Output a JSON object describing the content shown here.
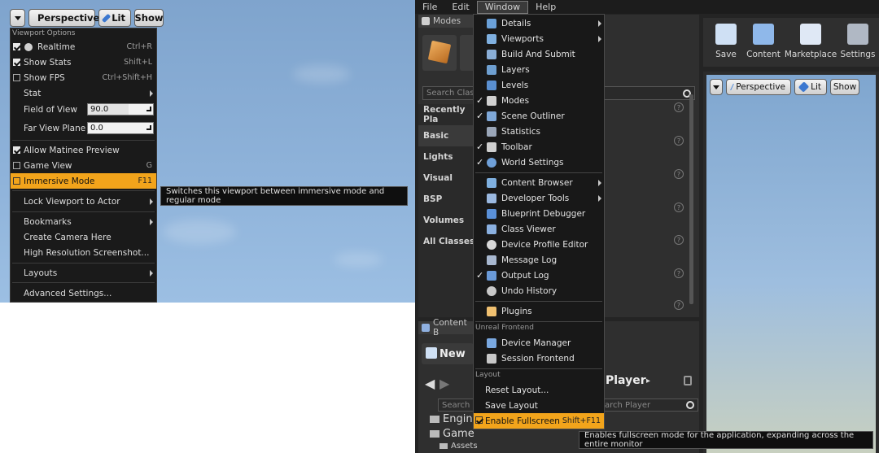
{
  "left_viewport": {
    "toolbar": {
      "perspective_label": "Perspective",
      "lit_label": "Lit",
      "show_label": "Show"
    },
    "menu": {
      "header": "Viewport Options",
      "realtime": {
        "label": "Realtime",
        "shortcut": "Ctrl+R",
        "checked": true
      },
      "show_stats": {
        "label": "Show Stats",
        "shortcut": "Shift+L",
        "checked": true
      },
      "show_fps": {
        "label": "Show FPS",
        "shortcut": "Ctrl+Shift+H",
        "checked": false
      },
      "stat_label": "Stat",
      "fov_label": "Field of View",
      "fov_value": "90.0",
      "far_view_label": "Far View Plane",
      "far_view_value": "0.0",
      "matinee": {
        "label": "Allow Matinee Preview",
        "checked": true
      },
      "game_view": {
        "label": "Game View",
        "shortcut": "G",
        "checked": false
      },
      "immersive": {
        "label": "Immersive Mode",
        "shortcut": "F11",
        "checked": false
      },
      "lock_viewport": "Lock Viewport to Actor",
      "bookmarks": "Bookmarks",
      "create_camera": "Create Camera Here",
      "hires_screenshot": "High Resolution Screenshot...",
      "layouts": "Layouts",
      "advanced": "Advanced Settings..."
    },
    "tooltip": "Switches this viewport between immersive mode and regular mode"
  },
  "editor": {
    "menubar": [
      "File",
      "Edit",
      "Window",
      "Help"
    ],
    "modes_tab": "Modes",
    "search_placeholder": "Search Clas",
    "categories": [
      "Recently Pla",
      "Basic",
      "Lights",
      "Visual",
      "BSP",
      "Volumes",
      "All Classes"
    ],
    "toolbar": {
      "save": "Save",
      "content": "Content",
      "marketplace": "Marketplace",
      "settings": "Settings"
    },
    "viewport": {
      "perspective": "Perspective",
      "lit": "Lit",
      "show": "Show"
    },
    "content_browser": {
      "tab": "Content B",
      "new_label": "New",
      "search_placeholder": "Search F",
      "player_label": "Player",
      "search_player_placeholder": "arch Player",
      "tree": [
        "Engine",
        "Game",
        "Assets"
      ]
    },
    "window_menu": {
      "items": [
        {
          "label": "Details",
          "sub": true,
          "checked": false,
          "icon": "details-icon",
          "color": "#6aa0d8"
        },
        {
          "label": "Viewports",
          "sub": true,
          "checked": false,
          "icon": "viewports-icon",
          "color": "#7fb0e0"
        },
        {
          "label": "Build And Submit",
          "sub": false,
          "checked": false,
          "icon": "build-icon",
          "color": "#8aaed6"
        },
        {
          "label": "Layers",
          "sub": false,
          "checked": false,
          "icon": "layers-icon",
          "color": "#6e9fd0"
        },
        {
          "label": "Levels",
          "sub": false,
          "checked": false,
          "icon": "levels-icon",
          "color": "#5a8fd0"
        },
        {
          "label": "Modes",
          "sub": false,
          "checked": true,
          "icon": "wrench-icon",
          "color": "#d0d0d0"
        },
        {
          "label": "Scene Outliner",
          "sub": false,
          "checked": true,
          "icon": "outliner-icon",
          "color": "#7fa8d8"
        },
        {
          "label": "Statistics",
          "sub": false,
          "checked": false,
          "icon": "statistics-icon",
          "color": "#9aa6b8"
        },
        {
          "label": "Toolbar",
          "sub": false,
          "checked": true,
          "icon": "toolbar-icon",
          "color": "#cfcfcf"
        },
        {
          "label": "World Settings",
          "sub": false,
          "checked": true,
          "icon": "globe-icon",
          "color": "#6fa0d8"
        }
      ],
      "items2": [
        {
          "label": "Content Browser",
          "sub": true,
          "icon": "content-browser-icon",
          "color": "#7fb0e0"
        },
        {
          "label": "Developer Tools",
          "sub": true,
          "icon": "developer-tools-icon",
          "color": "#9ab8e0"
        },
        {
          "label": "Blueprint Debugger",
          "sub": false,
          "icon": "blueprint-debugger-icon",
          "color": "#5a90d8"
        },
        {
          "label": "Class Viewer",
          "sub": false,
          "icon": "class-viewer-icon",
          "color": "#8ab0e0"
        },
        {
          "label": "Device Profile Editor",
          "sub": false,
          "icon": "device-profile-icon",
          "color": "#d8d8d8"
        },
        {
          "label": "Message Log",
          "sub": false,
          "icon": "message-log-icon",
          "color": "#a8b8d0"
        },
        {
          "label": "Output Log",
          "sub": false,
          "checked": true,
          "icon": "output-log-icon",
          "color": "#6a9ad8"
        },
        {
          "label": "Undo History",
          "sub": false,
          "icon": "undo-history-icon",
          "color": "#c8c8c8"
        }
      ],
      "plugins": "Plugins",
      "unreal_frontend_header": "Unreal Frontend",
      "device_manager": "Device Manager",
      "session_frontend": "Session Frontend",
      "layout_header": "Layout",
      "reset_layout": "Reset Layout...",
      "save_layout": "Save Layout",
      "enable_fullscreen": {
        "label": "Enable Fullscreen",
        "shortcut": "Shift+F11",
        "checked": true
      }
    },
    "fullscreen_tooltip": "Enables fullscreen mode for the application, expanding across the entire monitor"
  }
}
